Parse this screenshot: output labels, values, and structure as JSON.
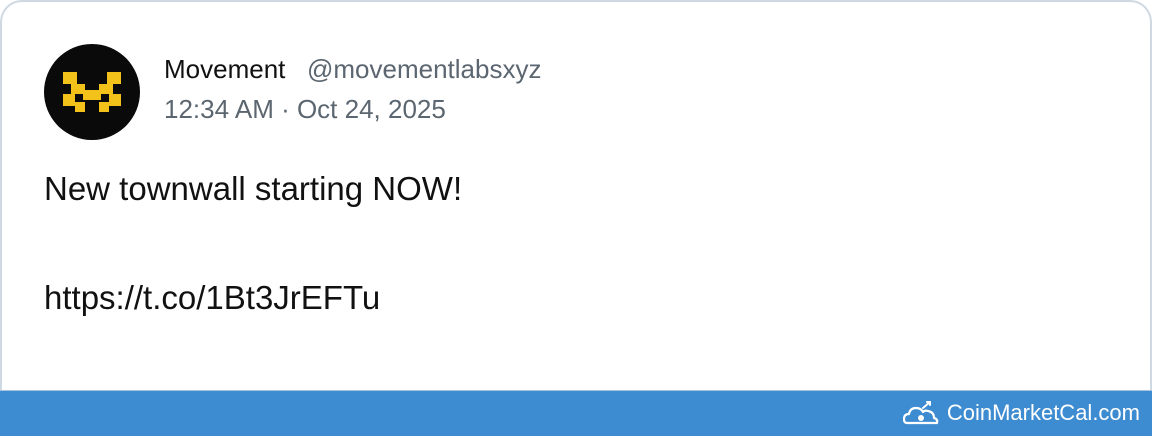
{
  "tweet": {
    "author_name": "Movement",
    "author_handle": "@movementlabsxyz",
    "timestamp": "12:34 AM · Oct 24, 2025",
    "text": "New townwall starting NOW!",
    "link": "https://t.co/1Bt3JrEFTu",
    "avatar_icon": "movement-logo-icon",
    "avatar_bg": "#0a0a0a",
    "avatar_logo_color": "#f2c21b"
  },
  "footer": {
    "brand": "CoinMarketCal.com",
    "brand_icon": "coinmarketcal-logo-icon",
    "bg_color": "#3d8bd0"
  }
}
